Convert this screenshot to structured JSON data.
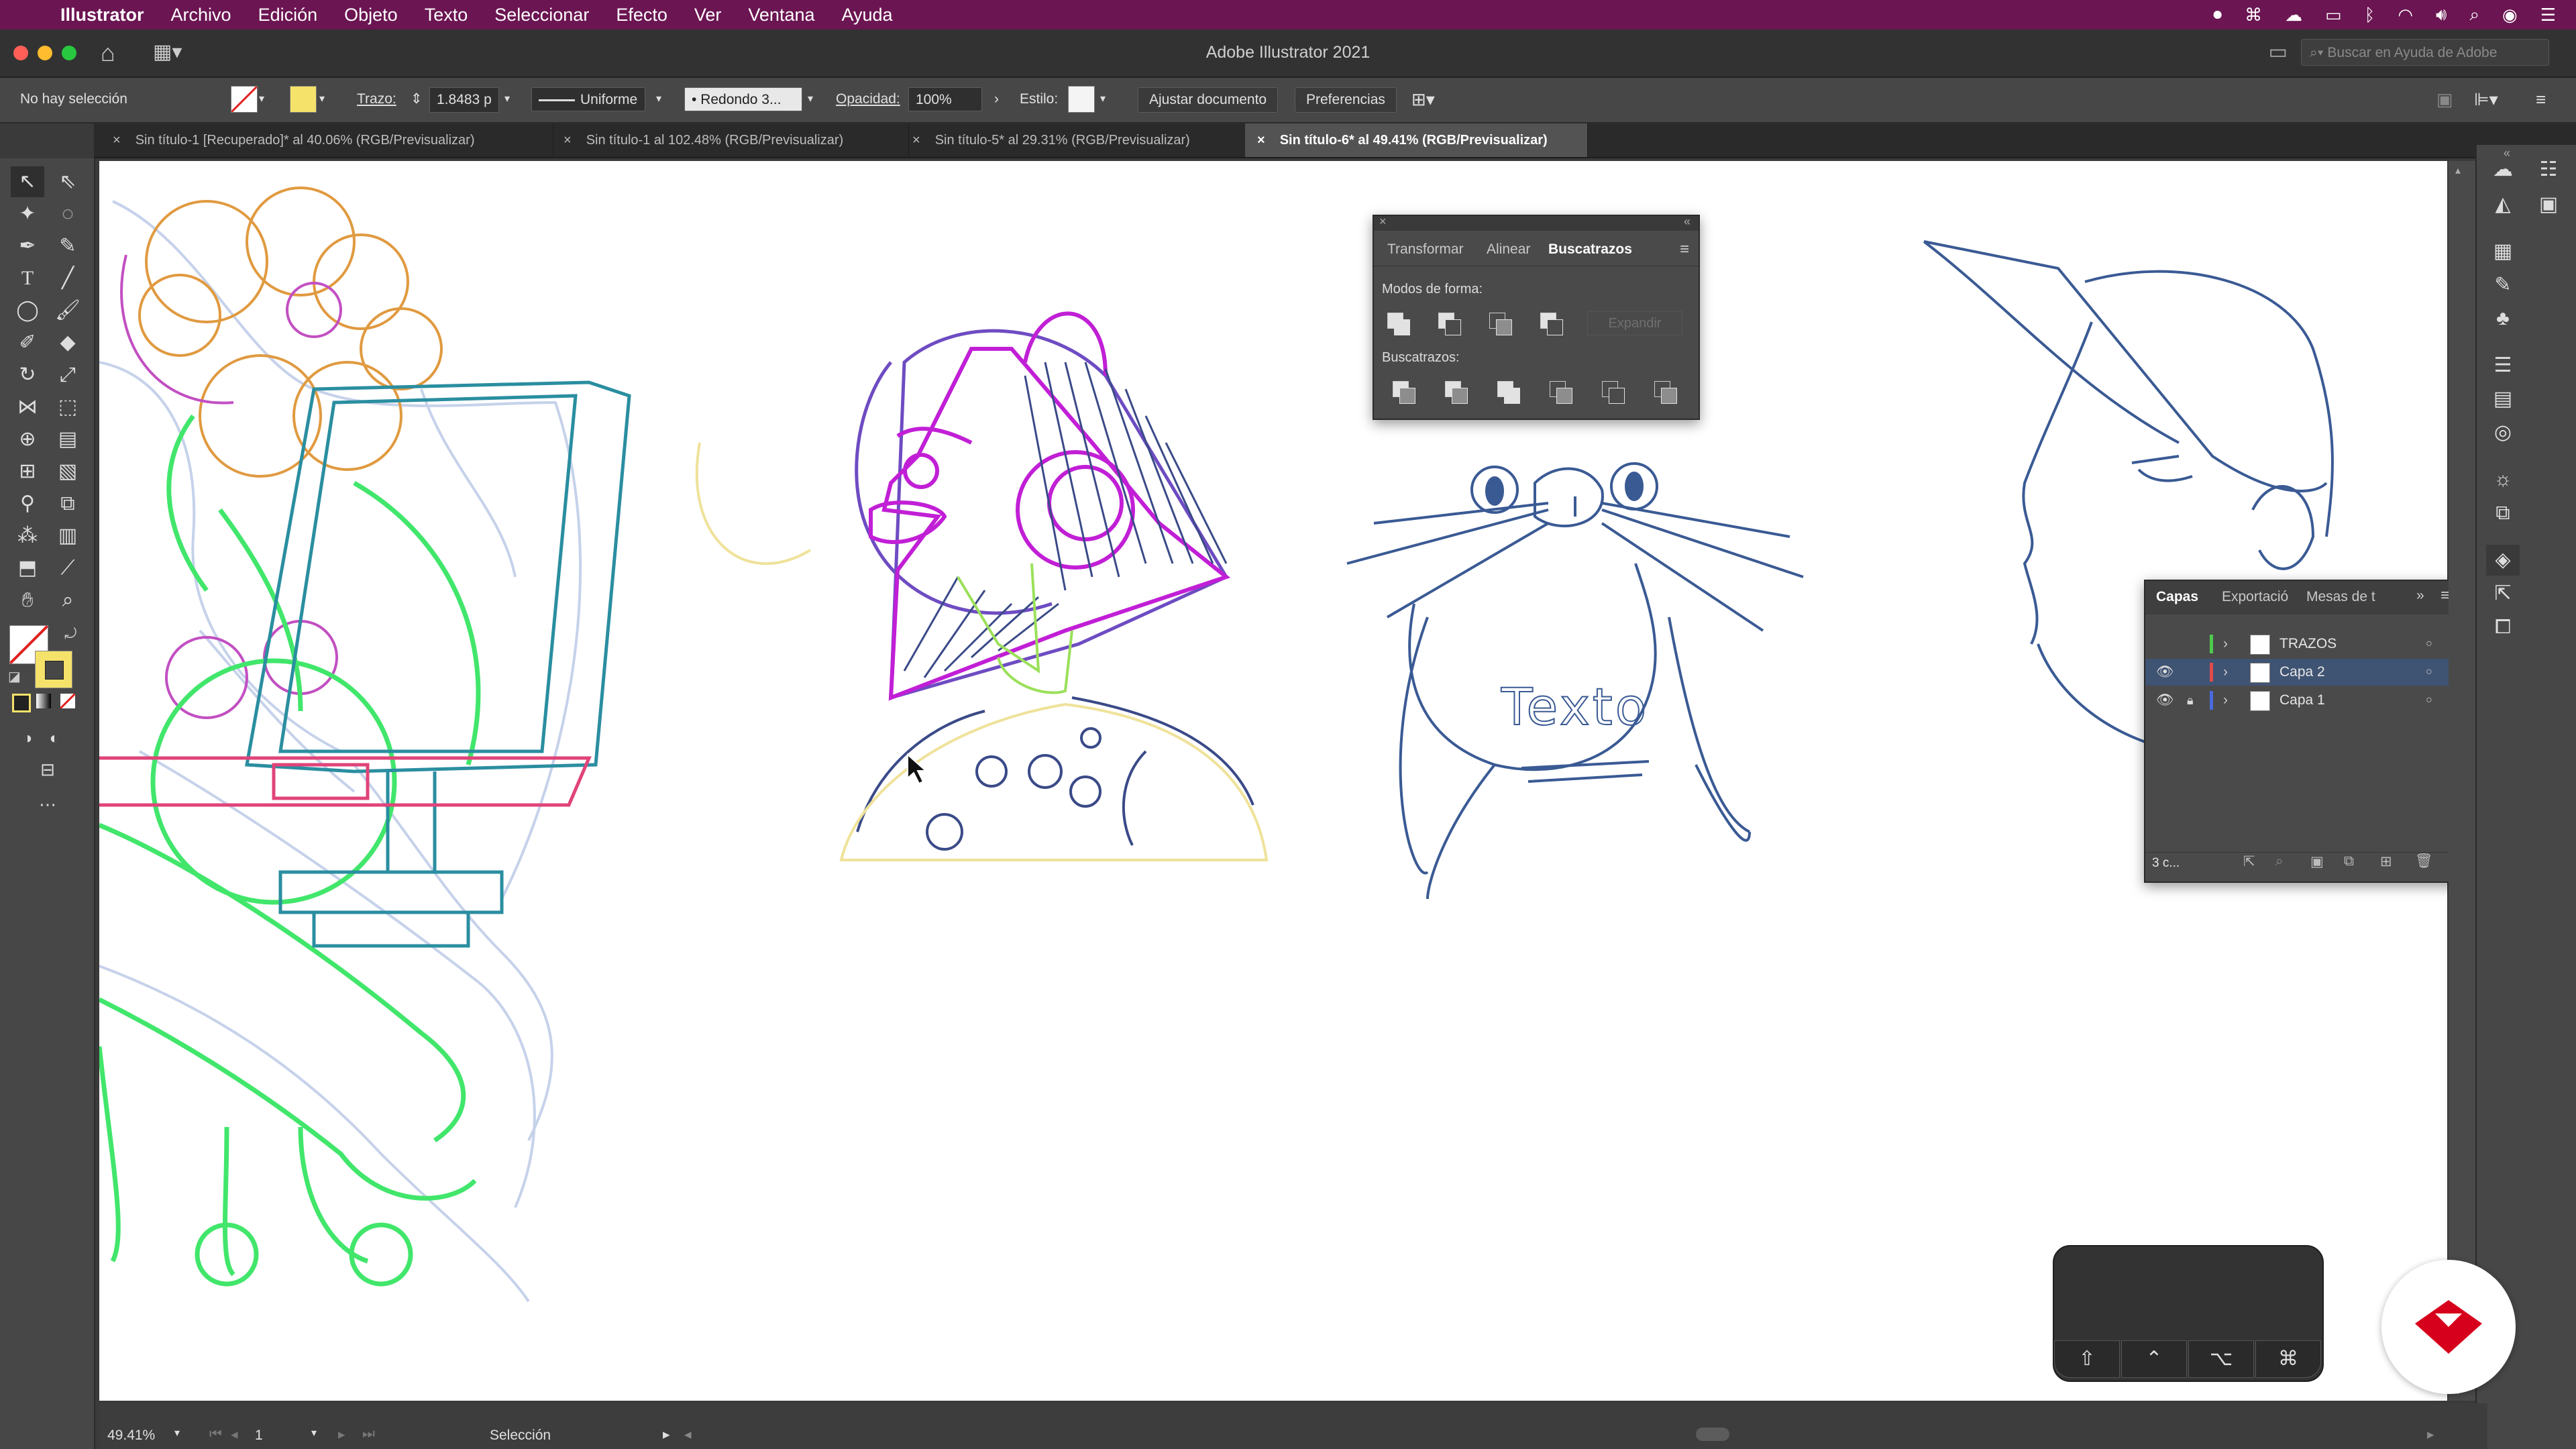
{
  "menubar": {
    "app": "Illustrator",
    "items": [
      "Archivo",
      "Edición",
      "Objeto",
      "Texto",
      "Seleccionar",
      "Efecto",
      "Ver",
      "Ventana",
      "Ayuda"
    ]
  },
  "window": {
    "title": "Adobe Illustrator 2021",
    "search_placeholder": "Buscar en Ayuda de Adobe"
  },
  "control_bar": {
    "selection_status": "No hay selección",
    "stroke_label": "Trazo:",
    "stroke_weight": "1.8483 p",
    "profile": "Uniforme",
    "brush": "Redondo 3...",
    "opacity_label": "Opacidad:",
    "opacity": "100%",
    "style_label": "Estilo:",
    "fit_document": "Ajustar documento",
    "preferences": "Preferencias"
  },
  "doc_tabs": [
    {
      "label": "Sin título-1 [Recuperado]* al 40.06% (RGB/Previsualizar)",
      "active": false
    },
    {
      "label": "Sin título-1 al 102.48% (RGB/Previsualizar)",
      "active": false
    },
    {
      "label": "Sin título-5* al 29.31% (RGB/Previsualizar)",
      "active": false
    },
    {
      "label": "Sin título-6* al 49.41% (RGB/Previsualizar)",
      "active": true
    }
  ],
  "pathfinder_panel": {
    "tabs": [
      "Transformar",
      "Alinear",
      "Buscatrazos"
    ],
    "shape_modes_label": "Modos de forma:",
    "expand": "Expandir",
    "pathfinders_label": "Buscatrazos:"
  },
  "layers_panel": {
    "tabs": [
      "Capas",
      "Exportació",
      "Mesas de t"
    ],
    "layers": [
      {
        "name": "TRAZOS",
        "color": "#4ccc4c",
        "visible": false,
        "locked": false
      },
      {
        "name": "Capa 2",
        "color": "#e04a4a",
        "visible": true,
        "locked": false
      },
      {
        "name": "Capa 1",
        "color": "#4a6ae0",
        "visible": true,
        "locked": true
      }
    ],
    "count": "3 c..."
  },
  "canvas": {
    "sketch_text": "Texto"
  },
  "status_bar": {
    "zoom": "49.41%",
    "artboard": "1",
    "tool": "Selección"
  },
  "touch_bar": {
    "keys": [
      "⇧",
      "⌃",
      "⌥",
      "⌘"
    ]
  }
}
